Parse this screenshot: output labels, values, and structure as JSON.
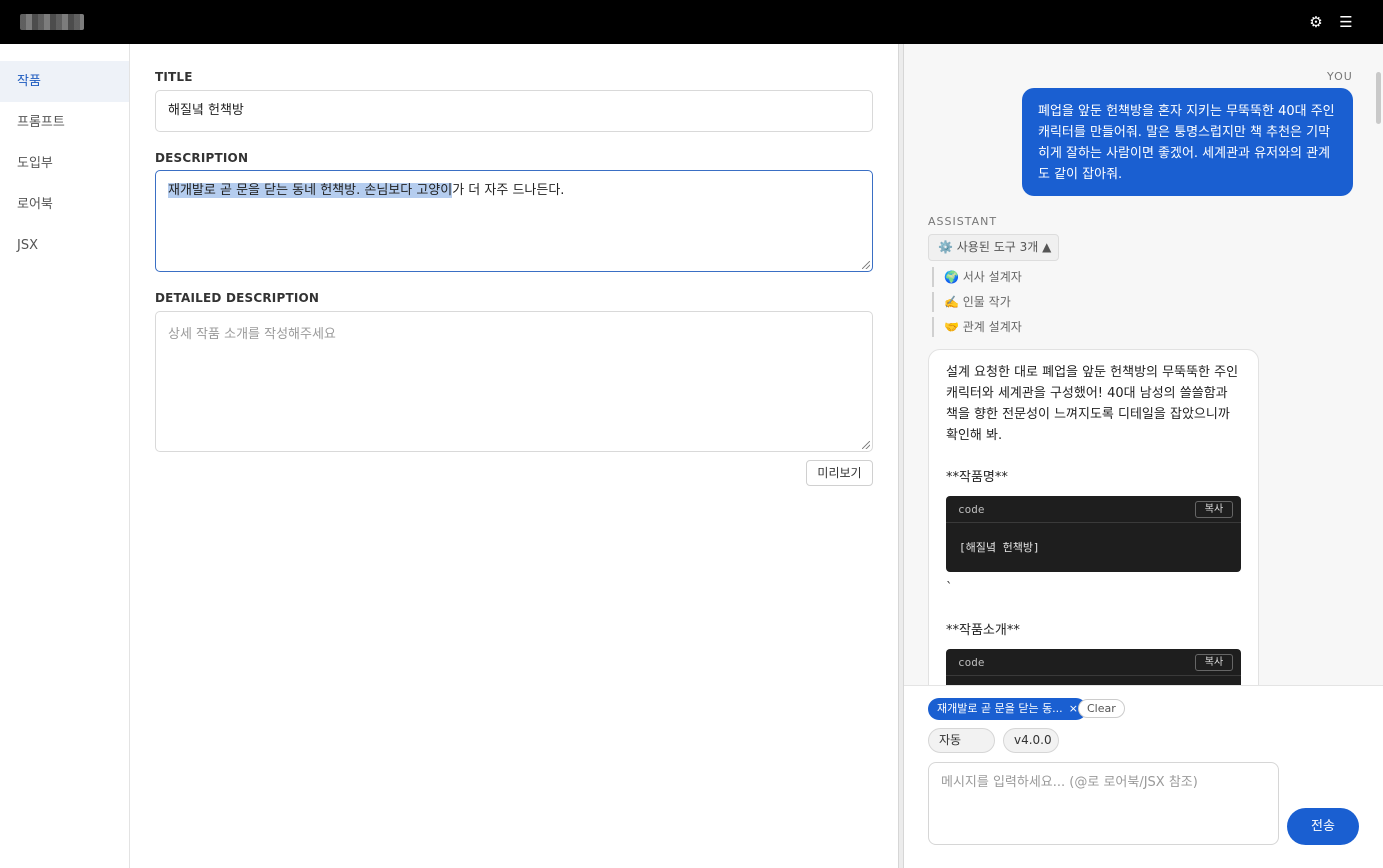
{
  "header": {
    "settings_icon": "gear-icon",
    "menu_icon": "hamburger-menu-icon"
  },
  "sidebar": {
    "items": [
      {
        "label": "작품",
        "active": true
      },
      {
        "label": "프롬프트",
        "active": false
      },
      {
        "label": "도입부",
        "active": false
      },
      {
        "label": "로어북",
        "active": false
      },
      {
        "label": "JSX",
        "active": false
      }
    ]
  },
  "form": {
    "title_label": "TITLE",
    "title_value": "해질녘 헌책방",
    "description_label": "DESCRIPTION",
    "description_selected": "재개발로 곧 문을 닫는 동네 헌책방. 손님보다 고양이",
    "description_rest": "가 더 자주 드나든다.",
    "detailed_label": "DETAILED DESCRIPTION",
    "detailed_placeholder": "상세 작품 소개를 작성해주세요",
    "preview_button": "미리보기"
  },
  "chat": {
    "you_label": "YOU",
    "user_message": "폐업을 앞둔 헌책방을 혼자 지키는 무뚝뚝한 40대 주인 캐릭터를 만들어줘. 말은 퉁명스럽지만 책 추천은 기막히게 잘하는 사람이면 좋겠어. 세계관과 유저와의 관계도 같이 잡아줘.",
    "assistant_label": "ASSISTANT",
    "tools_toggle": "⚙️ 사용된 도구 3개 ▲",
    "tools": [
      "🌍 서사 설계자",
      "✍️ 인물 작가",
      "🤝 관계 설계자"
    ],
    "assistant_intro": "설계 요청한 대로 폐업을 앞둔 헌책방의 무뚝뚝한 주인 캐릭터와 세계관을 구성했어! 40대 남성의 쓸쓸함과 책을 향한 전문성이 느껴지도록 디테일을 잡았으니까 확인해 봐.",
    "section1_heading": "**작품명**",
    "code1_lang": "code",
    "code1_copy": "복사",
    "code1_body": "[해질녘 헌책방]",
    "stray_backtick": "`",
    "section2_heading": "**작품소개**",
    "code2_lang": "code",
    "code2_copy": "복사"
  },
  "composer": {
    "context_chip": "재개발로 곧 문을 닫는 동...",
    "chip_close": "×",
    "clear_button": "Clear",
    "mode_select": "자동",
    "version_select": "v4.0.0",
    "message_placeholder": "메시지를 입력하세요... (@로 로어북/JSX 참조)",
    "send_button": "전송"
  },
  "colors": {
    "accent": "#1a5fd1",
    "selection": "#b5cdef",
    "topbar": "#000000"
  }
}
